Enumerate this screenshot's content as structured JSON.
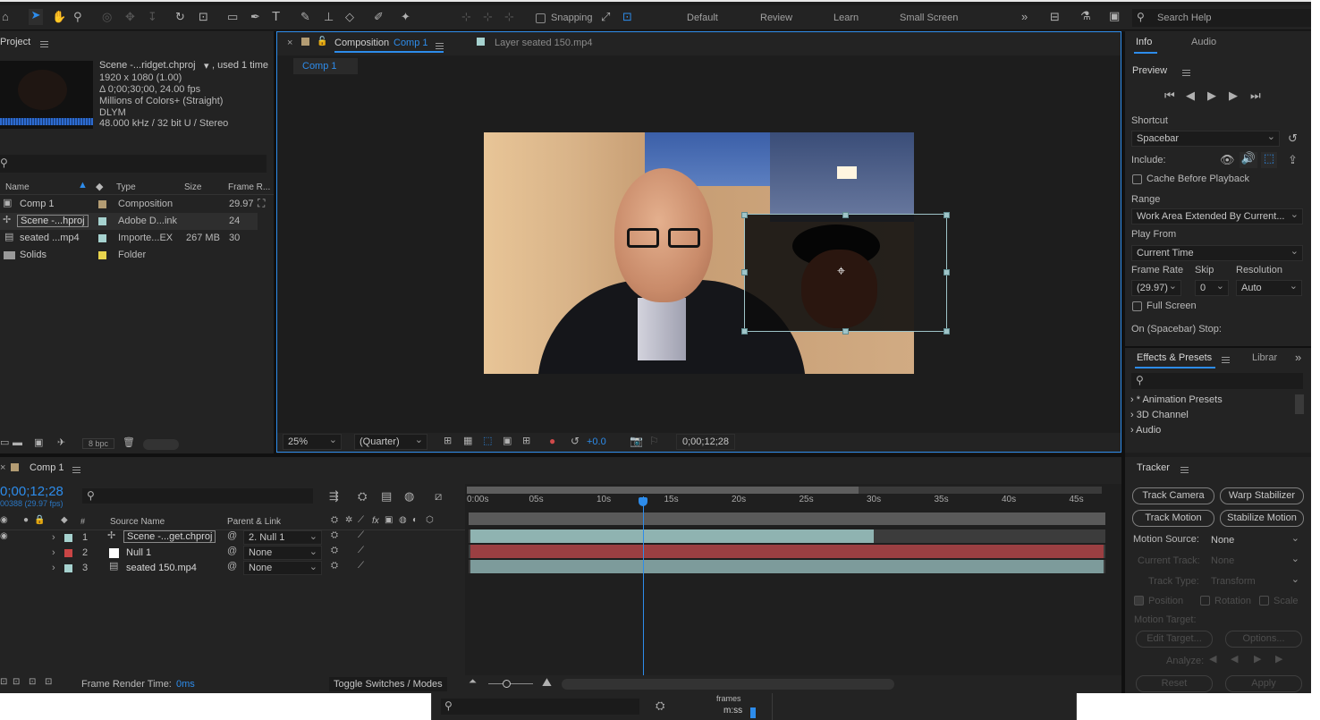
{
  "toolbar": {
    "snapping_label": "Snapping",
    "workspaces": [
      "Default",
      "Review",
      "Learn",
      "Small Screen"
    ],
    "search_placeholder": "Search Help"
  },
  "project": {
    "title": "Project",
    "selected_name": "Scene -...ridget.chproj",
    "used_count": ", used 1 time",
    "info_lines": [
      "1920 x 1080 (1.00)",
      "Δ 0;00;30;00, 24.00 fps",
      "Millions of Colors+ (Straight)",
      "DLYM",
      "48.000 kHz / 32 bit U / Stereo"
    ],
    "search_placeholder": "",
    "columns": [
      "Name",
      "Type",
      "Size",
      "Frame R..."
    ],
    "items": [
      {
        "name": "Comp 1",
        "type": "Composition",
        "size": "",
        "fps": "29.97",
        "color": "#b39c73"
      },
      {
        "name": "Scene -...hproj",
        "type": "Adobe D...ink",
        "size": "",
        "fps": "24",
        "color": "#a6d2cf"
      },
      {
        "name": "seated ...mp4",
        "type": "Importe...EX",
        "size": "267 MB",
        "fps": "30",
        "color": "#a6d2cf"
      },
      {
        "name": "Solids",
        "type": "Folder",
        "size": "",
        "fps": "",
        "color": "#e8d44d"
      }
    ],
    "bpc": "8 bpc"
  },
  "viewer": {
    "tab_composition_prefix": "Composition",
    "tab_composition_name": "Comp 1",
    "tab_layer": "Layer  seated 150.mp4",
    "comp_chip": "Comp 1",
    "zoom": "25%",
    "resolution": "(Quarter)",
    "exposure": "+0.0",
    "timecode": "0;00;12;28"
  },
  "info_panel": {
    "tabs": [
      "Info",
      "Audio"
    ],
    "preview_title": "Preview",
    "shortcut_label": "Shortcut",
    "shortcut_value": "Spacebar",
    "include_label": "Include:",
    "cache_label": "Cache Before Playback",
    "range_label": "Range",
    "range_value": "Work Area Extended By Current...",
    "play_from_label": "Play From",
    "play_from_value": "Current Time",
    "frame_rate_label": "Frame Rate",
    "frame_rate_value": "(29.97)",
    "skip_label": "Skip",
    "skip_value": "0",
    "resolution_label": "Resolution",
    "resolution_value": "Auto",
    "full_screen_label": "Full Screen",
    "on_stop_label": "On (Spacebar) Stop:"
  },
  "effects": {
    "tab": "Effects & Presets",
    "tab2": "Librar",
    "items": [
      "* Animation Presets",
      "3D Channel",
      "Audio"
    ]
  },
  "timeline": {
    "tab": "Comp 1",
    "current_time": "0;00;12;28",
    "frame_info": "00388 (29.97 fps)",
    "ruler": [
      "0:00s",
      "05s",
      "10s",
      "15s",
      "20s",
      "25s",
      "30s",
      "35s",
      "40s",
      "45s"
    ],
    "col_num": "#",
    "col_source": "Source Name",
    "col_parent": "Parent & Link",
    "layers": [
      {
        "num": "1",
        "name": "Scene -...get.chproj",
        "parent": "2. Null 1",
        "color": "#a6d2cf",
        "bar_color": "#8fb3b1",
        "bar_end_sec": 30
      },
      {
        "num": "2",
        "name": "Null 1",
        "parent": "None",
        "color": "#c94545",
        "bar_color": "#9b3f42",
        "bar_end_sec": 47
      },
      {
        "num": "3",
        "name": "seated 150.mp4",
        "parent": "None",
        "color": "#a6d2cf",
        "bar_color": "#7d9b9b",
        "bar_end_sec": 47
      }
    ],
    "current_time_sec": 12.93,
    "work_area_end_sec": 29,
    "render_time_label": "Frame Render Time:",
    "render_time_value": "0ms",
    "toggle_label": "Toggle Switches / Modes"
  },
  "tracker": {
    "title": "Tracker",
    "buttons": [
      "Track Camera",
      "Warp Stabilizer",
      "Track Motion",
      "Stabilize Motion"
    ],
    "motion_source_label": "Motion Source:",
    "motion_source_value": "None",
    "current_track_label": "Current Track:",
    "current_track_value": "None",
    "track_type_label": "Track Type:",
    "track_type_value": "Transform",
    "position_label": "Position",
    "rotation_label": "Rotation",
    "scale_label": "Scale",
    "motion_target_label": "Motion Target:",
    "edit_target": "Edit Target...",
    "options": "Options...",
    "analyze_label": "Analyze:",
    "reset": "Reset",
    "apply": "Apply"
  },
  "bottom_strip": {
    "frames_label": "frames",
    "mss_label": "m:ss"
  },
  "colors": {
    "accent": "#2d8ceb",
    "panel_bg": "#232323",
    "app_bg": "#1d1d1d"
  }
}
